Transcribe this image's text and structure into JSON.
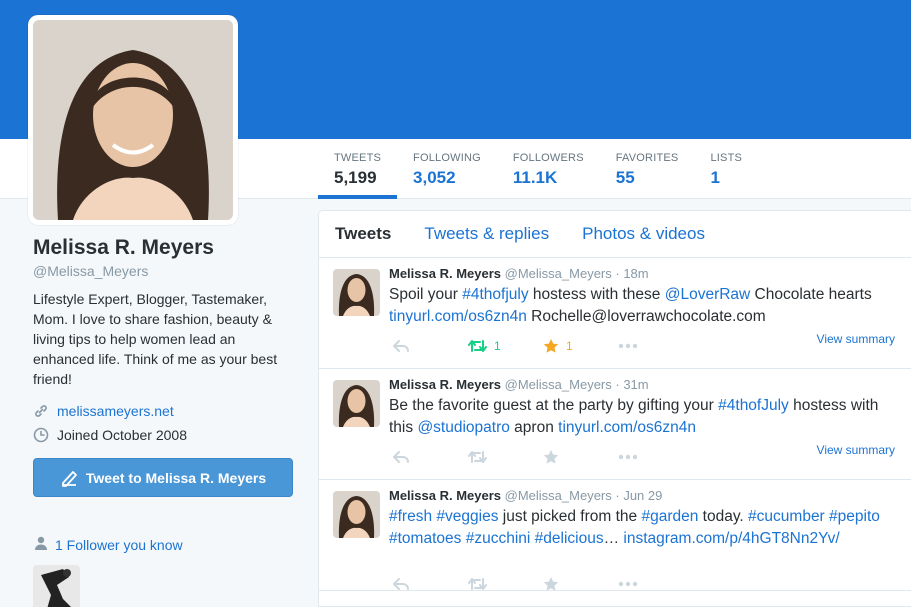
{
  "profile": {
    "name": "Melissa R. Meyers",
    "handle": "@Melissa_Meyers",
    "bio": "Lifestyle Expert, Blogger, Tastemaker, Mom. I love to share fashion, beauty & living tips to help women lead an enhanced life. Think of me as your best friend!",
    "website": "melissameyers.net",
    "joined": "Joined October 2008",
    "tweet_to_label": "Tweet to Melissa R. Meyers",
    "followers_you_know": "1 Follower you know"
  },
  "stats": [
    {
      "label": "TWEETS",
      "value": "5,199"
    },
    {
      "label": "FOLLOWING",
      "value": "3,052"
    },
    {
      "label": "FOLLOWERS",
      "value": "11.1K"
    },
    {
      "label": "FAVORITES",
      "value": "55"
    },
    {
      "label": "LISTS",
      "value": "1"
    }
  ],
  "tabs": [
    "Tweets",
    "Tweets & replies",
    "Photos & videos"
  ],
  "tweets": [
    {
      "name": "Melissa R. Meyers",
      "handle": "@Melissa_Meyers",
      "time": "· 18m",
      "text_segments": [
        {
          "t": "Spoil your ",
          "link": false
        },
        {
          "t": "#4thofjuly",
          "link": true
        },
        {
          "t": " hostess with these ",
          "link": false
        },
        {
          "t": "@LoverRaw",
          "link": true
        },
        {
          "t": " Chocolate hearts ",
          "link": false
        },
        {
          "t": "tinyurl.com/os6zn4n",
          "link": true
        },
        {
          "t": " Rochelle@loverrawchocolate.com",
          "link": false
        }
      ],
      "retweets": "1",
      "favorites": "1",
      "summary": "View summary"
    },
    {
      "name": "Melissa R. Meyers",
      "handle": "@Melissa_Meyers",
      "time": "· 31m",
      "text_segments": [
        {
          "t": "Be the favorite guest at the party by gifting your ",
          "link": false
        },
        {
          "t": "#4thofJuly",
          "link": true
        },
        {
          "t": " hostess with this ",
          "link": false
        },
        {
          "t": "@studiopatro",
          "link": true
        },
        {
          "t": " apron ",
          "link": false
        },
        {
          "t": "tinyurl.com/os6zn4n",
          "link": true
        }
      ],
      "retweets": "",
      "favorites": "",
      "summary": "View summary"
    },
    {
      "name": "Melissa R. Meyers",
      "handle": "@Melissa_Meyers",
      "time": "· Jun 29",
      "text_segments": [
        {
          "t": "#fresh",
          "link": true
        },
        {
          "t": " ",
          "link": false
        },
        {
          "t": "#veggies",
          "link": true
        },
        {
          "t": " just picked from the ",
          "link": false
        },
        {
          "t": "#garden",
          "link": true
        },
        {
          "t": " today. ",
          "link": false
        },
        {
          "t": "#cucumber",
          "link": true
        },
        {
          "t": " ",
          "link": false
        },
        {
          "t": "#pepito",
          "link": true
        },
        {
          "t": " ",
          "link": false
        },
        {
          "t": "#tomatoes",
          "link": true
        },
        {
          "t": " ",
          "link": false
        },
        {
          "t": "#zucchini",
          "link": true
        },
        {
          "t": " ",
          "link": false
        },
        {
          "t": "#delicious",
          "link": true
        },
        {
          "t": "… ",
          "link": false
        },
        {
          "t": "instagram.com/p/4hGT8Nn2Yv/",
          "link": true
        }
      ],
      "retweets": "",
      "favorites": "",
      "summary": ""
    }
  ],
  "colors": {
    "brand": "#1b73d3",
    "button": "#4a97d8",
    "retweet": "#19cf86",
    "favorite": "#f5a623",
    "muted": "#8899a6"
  }
}
